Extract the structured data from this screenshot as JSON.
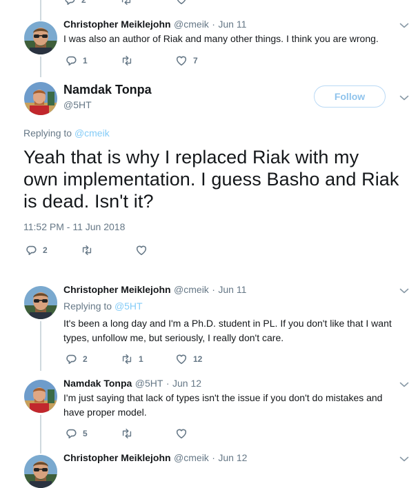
{
  "colors": {
    "accent": "#1da1f2",
    "muted": "#657786",
    "text": "#14171a",
    "thread_line": "#cfd9de"
  },
  "top_fragment": {
    "reply_count": "2"
  },
  "tweet1": {
    "name": "Christopher Meiklejohn",
    "handle": "@cmeik",
    "date": "Jun 11",
    "text": "I was also an author of Riak and many other things.  I think you are wrong.",
    "replies": "1",
    "retweets": "",
    "likes": "7"
  },
  "main_tweet": {
    "name": "Namdak Tonpa",
    "handle": "@5HT",
    "follow_label": "Follow",
    "replying_prefix": "Replying to",
    "replying_user": "@cmeik",
    "text_line1": "Yeah that is why I replaced Riak with my",
    "text_line2": "own implementation. I guess Basho and Riak",
    "text_line3": "is dead. Isn't it?",
    "timestamp": "11:52 PM - 11 Jun 2018",
    "replies": "2"
  },
  "tweet2": {
    "name": "Christopher Meiklejohn",
    "handle": "@cmeik",
    "date": "Jun 11",
    "replying_prefix": "Replying to",
    "replying_user": "@5HT",
    "text_line1": "It's been a long day and I'm a Ph.D. student in PL.  If you don't like that I want",
    "text_line2": "types, unfollow me, but seriously, I really don't care.",
    "replies": "2",
    "retweets": "1",
    "likes": "12"
  },
  "tweet3": {
    "name": "Namdak Tonpa",
    "handle": "@5HT",
    "date": "Jun 12",
    "text_line1": "I'm just saying that lack of types isn't the issue if you don't do mistakes and",
    "text_line2": "have proper model.",
    "replies": "5"
  },
  "tweet4": {
    "name": "Christopher Meiklejohn",
    "handle": "@cmeik",
    "date": "Jun 12"
  },
  "separator": "·"
}
